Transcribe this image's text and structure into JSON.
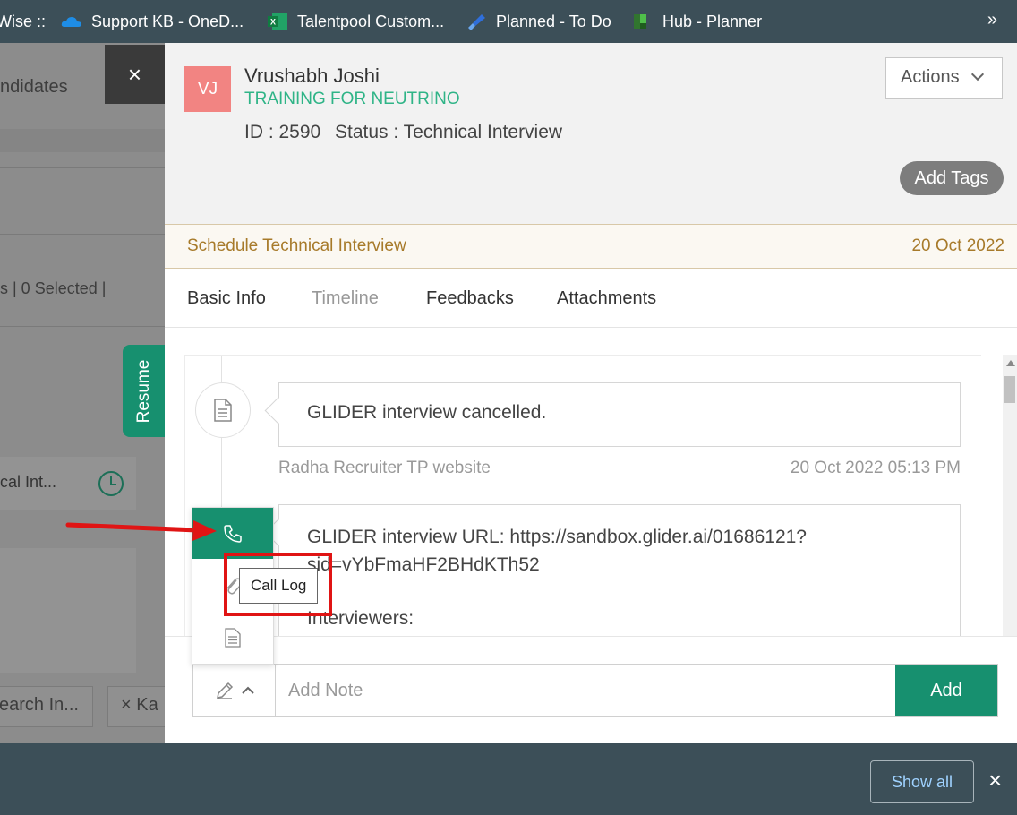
{
  "bookmarks": {
    "items": [
      {
        "label": "Wise ::",
        "icon": "none"
      },
      {
        "label": "Support KB - OneD...",
        "icon": "onedrive-cloud-icon"
      },
      {
        "label": "Talentpool Custom...",
        "icon": "excel-icon"
      },
      {
        "label": "Planned - To Do",
        "icon": "todo-icon"
      },
      {
        "label": "Hub - Planner",
        "icon": "planner-icon"
      }
    ],
    "more": "»"
  },
  "background": {
    "tab_label": "ndidates",
    "selected_label": "s   |   0 Selected   |",
    "card_text": "cal Int...",
    "search_label": "earch In...",
    "chip_label": "× Ka"
  },
  "close_panel": "×",
  "resume_tab": "Resume",
  "candidate": {
    "initials": "VJ",
    "name": "Vrushabh Joshi",
    "job": "TRAINING FOR NEUTRINO",
    "id_label": "ID : 2590",
    "status_label": "Status : Technical Interview",
    "actions_label": "Actions",
    "add_tags_label": "Add Tags"
  },
  "schedule": {
    "title": "Schedule Technical Interview",
    "date": "20 Oct 2022"
  },
  "tabs": [
    {
      "label": "Basic Info",
      "active": false
    },
    {
      "label": "Timeline",
      "active": true
    },
    {
      "label": "Feedbacks",
      "active": false
    },
    {
      "label": "Attachments",
      "active": false
    }
  ],
  "timeline": {
    "items": [
      {
        "text": "GLIDER interview cancelled.",
        "author": "Radha Recruiter TP website",
        "time": "20 Oct 2022 05:13 PM"
      },
      {
        "text_line1": "GLIDER interview URL: https://sandbox.glider.ai/01686121?",
        "text_line2": "sid=vYbFmaHF2BHdKTh52",
        "text_line3": "Interviewers:"
      }
    ]
  },
  "note": {
    "placeholder": "Add Note",
    "add_label": "Add"
  },
  "note_type_tooltip": "Call Log",
  "download_bar": {
    "show_all_label": "Show all",
    "close": "×"
  },
  "colors": {
    "accent_green": "#17906f",
    "job_green": "#2fb487",
    "avatar": "#f28482",
    "highlight_red": "#e01414"
  }
}
